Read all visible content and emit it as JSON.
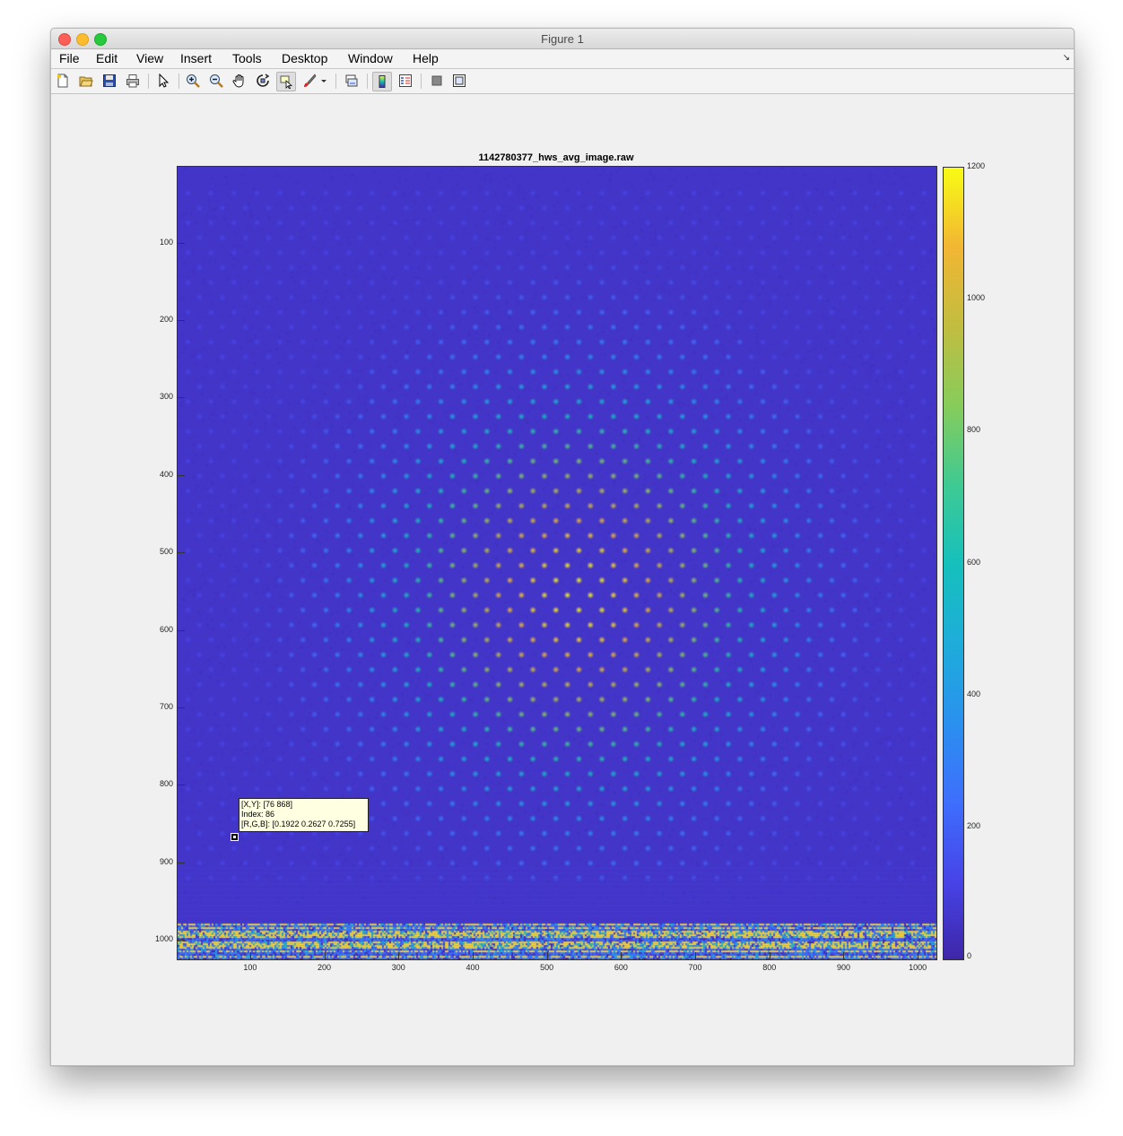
{
  "window": {
    "title": "Figure 1"
  },
  "menu": [
    "File",
    "Edit",
    "View",
    "Insert",
    "Tools",
    "Desktop",
    "Window",
    "Help"
  ],
  "toolbar": [
    {
      "name": "new-figure-icon"
    },
    {
      "name": "open-file-icon"
    },
    {
      "name": "save-icon"
    },
    {
      "name": "print-icon"
    },
    {
      "name": "edit-plot-arrow-icon"
    },
    {
      "name": "zoom-in-icon"
    },
    {
      "name": "zoom-out-icon"
    },
    {
      "name": "pan-hand-icon"
    },
    {
      "name": "rotate-3d-icon"
    },
    {
      "name": "data-cursor-icon"
    },
    {
      "name": "brush-icon"
    },
    {
      "name": "brush-dropdown-icon"
    },
    {
      "name": "link-plot-icon"
    },
    {
      "name": "colorbar-icon"
    },
    {
      "name": "legend-icon"
    },
    {
      "name": "hide-plot-tools-icon"
    },
    {
      "name": "show-plot-tools-icon"
    }
  ],
  "chart_data": {
    "type": "heatmap",
    "title": "1142780377_hws_avg_image.raw",
    "xlabel": "",
    "ylabel": "",
    "xlim": [
      1,
      1024
    ],
    "ylim": [
      1,
      1024
    ],
    "y_reversed": true,
    "x_ticks": [
      100,
      200,
      300,
      400,
      500,
      600,
      700,
      800,
      900,
      1000
    ],
    "y_ticks": [
      100,
      200,
      300,
      400,
      500,
      600,
      700,
      800,
      900,
      1000
    ],
    "colorbar": {
      "range": [
        0,
        1200
      ],
      "ticks": [
        0,
        200,
        400,
        600,
        800,
        1000,
        1200
      ],
      "colormap": "parula"
    },
    "background_value": 60,
    "spot_pitch": 31,
    "spot_peak_center": [
      540,
      550
    ],
    "spot_peak_value": 1200,
    "noise_band_rows": [
      978,
      1024
    ],
    "datatip": {
      "xy": "[X,Y]: [76 868]",
      "index": "Index: 86",
      "rgb": "[R,G,B]: [0.1922 0.2627 0.7255]",
      "x": 76,
      "y": 868
    }
  }
}
